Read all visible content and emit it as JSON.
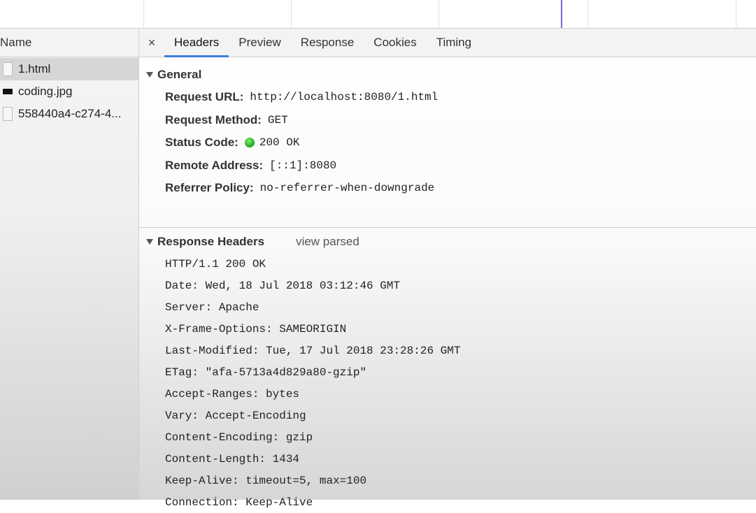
{
  "name_panel": {
    "header": "Name",
    "files": [
      {
        "name": "1.html",
        "type": "document",
        "selected": true
      },
      {
        "name": "coding.jpg",
        "type": "image",
        "selected": false
      },
      {
        "name": "558440a4-c274-4...",
        "type": "document",
        "selected": false
      }
    ]
  },
  "tabs": {
    "close": "×",
    "items": [
      "Headers",
      "Preview",
      "Response",
      "Cookies",
      "Timing"
    ],
    "active": "Headers"
  },
  "general": {
    "title": "General",
    "request_url_label": "Request URL:",
    "request_url": "http://localhost:8080/1.html",
    "request_method_label": "Request Method:",
    "request_method": "GET",
    "status_code_label": "Status Code:",
    "status_code": "200 OK",
    "remote_address_label": "Remote Address:",
    "remote_address": "[::1]:8080",
    "referrer_policy_label": "Referrer Policy:",
    "referrer_policy": "no-referrer-when-downgrade"
  },
  "response_headers": {
    "title": "Response Headers",
    "view_parsed": "view parsed",
    "lines": [
      "HTTP/1.1 200 OK",
      "Date: Wed, 18 Jul 2018 03:12:46 GMT",
      "Server: Apache",
      "X-Frame-Options: SAMEORIGIN",
      "Last-Modified: Tue, 17 Jul 2018 23:28:26 GMT",
      "ETag: \"afa-5713a4d829a80-gzip\"",
      "Accept-Ranges: bytes",
      "Vary: Accept-Encoding",
      "Content-Encoding: gzip",
      "Content-Length: 1434",
      "Keep-Alive: timeout=5, max=100",
      "Connection: Keep-Alive"
    ]
  },
  "colors": {
    "accent": "#3b7ddd",
    "status_ok": "#1ea31b"
  }
}
